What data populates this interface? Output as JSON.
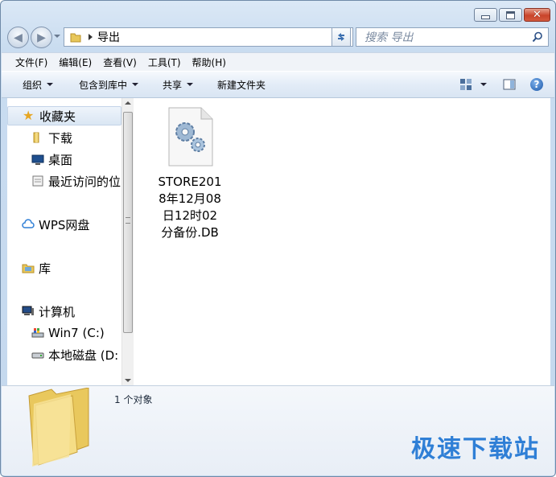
{
  "window": {
    "controls": [
      "minimize",
      "maximize",
      "close"
    ]
  },
  "nav": {
    "path": [
      "导出"
    ],
    "search_placeholder": "搜索 导出"
  },
  "menubar": [
    "文件(F)",
    "编辑(E)",
    "查看(V)",
    "工具(T)",
    "帮助(H)"
  ],
  "commandbar": {
    "organize": "组织",
    "include_library": "包含到库中",
    "share": "共享",
    "new_folder": "新建文件夹"
  },
  "sidebar": {
    "favorites": {
      "label": "收藏夹",
      "items": [
        "下载",
        "桌面",
        "最近访问的位"
      ]
    },
    "wps": "WPS网盘",
    "libraries": "库",
    "computer": {
      "label": "计算机",
      "items": [
        "Win7 (C:)",
        "本地磁盘 (D:"
      ]
    }
  },
  "files": [
    {
      "name_lines": [
        "STORE201",
        "8年12月08",
        "日12时02",
        "分备份.DB"
      ],
      "icon": "system-file-gears-icon"
    }
  ],
  "details": {
    "count": "1 个对象"
  },
  "watermark": "极速下载站",
  "colors": {
    "accent": "#2f7fd6",
    "frame": "#c4d8ee"
  }
}
